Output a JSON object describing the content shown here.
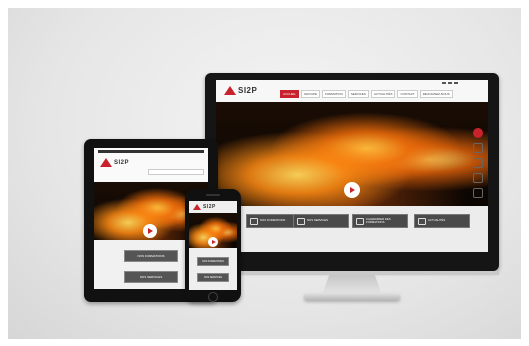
{
  "brand": {
    "logo_text": "SI2P",
    "accent_color": "#c8232c"
  },
  "desktop": {
    "util_links": [
      "",
      "",
      ""
    ],
    "nav_items": [
      "ACCUEIL",
      "GROUPE",
      "FORMATION",
      "SERVICES",
      "ACTUALITÉS",
      "CONTACT",
      "REJOIGNEZ-NOUS"
    ],
    "hero_caption": "",
    "tiles": [
      "NOS FORMATIONS",
      "NOS SERVICES",
      "CALENDRIER DES FORMATIONS",
      "ACTUALITÉS"
    ]
  },
  "tablet": {
    "buttons": [
      "NOS FORMATIONS",
      "NOS SERVICES"
    ]
  },
  "phone": {
    "buttons": [
      "NOS FORMATIONS",
      "NOS SERVICES"
    ]
  }
}
